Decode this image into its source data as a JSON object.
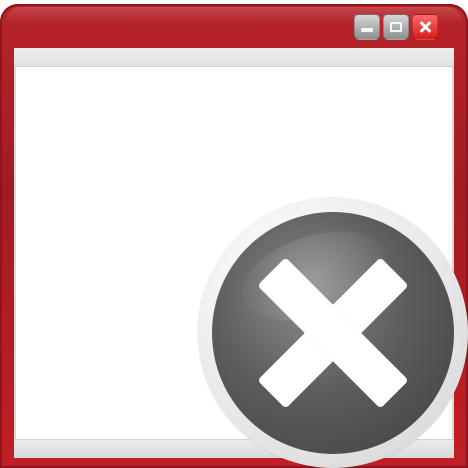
{
  "window": {
    "title": "",
    "controls": [
      {
        "icon": "minimize-icon"
      },
      {
        "icon": "maximize-icon"
      },
      {
        "icon": "close-icon"
      }
    ],
    "state_icon": "close-icon"
  },
  "colors": {
    "frame": "#b8242a",
    "frame_dark": "#8e151b",
    "client_background": "#ffffff",
    "client_strip": "#e5e5e5",
    "button_gray": "#b0b0b0",
    "button_red": "#e32727",
    "badge_outer": "#e6e6e6",
    "badge_inner": "#5e5e5e",
    "badge_x": "#ffffff"
  }
}
